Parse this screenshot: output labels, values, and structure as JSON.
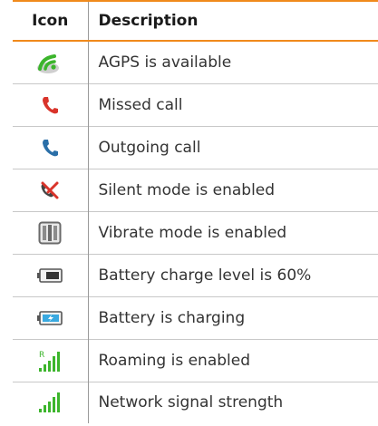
{
  "table": {
    "headers": {
      "icon": "Icon",
      "description": "Description"
    },
    "rows": [
      {
        "icon": "agps-icon",
        "description": "AGPS is available"
      },
      {
        "icon": "missed-call-icon",
        "description": "Missed call"
      },
      {
        "icon": "outgoing-call-icon",
        "description": "Outgoing call"
      },
      {
        "icon": "silent-mode-icon",
        "description": "Silent mode is enabled"
      },
      {
        "icon": "vibrate-mode-icon",
        "description": "Vibrate mode is enabled"
      },
      {
        "icon": "battery-60-icon",
        "description": "Battery charge level is 60%"
      },
      {
        "icon": "battery-charging-icon",
        "description": "Battery is charging"
      },
      {
        "icon": "roaming-icon",
        "description": "Roaming is enabled",
        "badge": "R"
      },
      {
        "icon": "signal-strength-icon",
        "description": "Network signal strength"
      }
    ]
  },
  "colors": {
    "accent": "#f08a1c",
    "green": "#3cb52c",
    "red": "#d9342b",
    "blue": "#2a6fa8"
  }
}
